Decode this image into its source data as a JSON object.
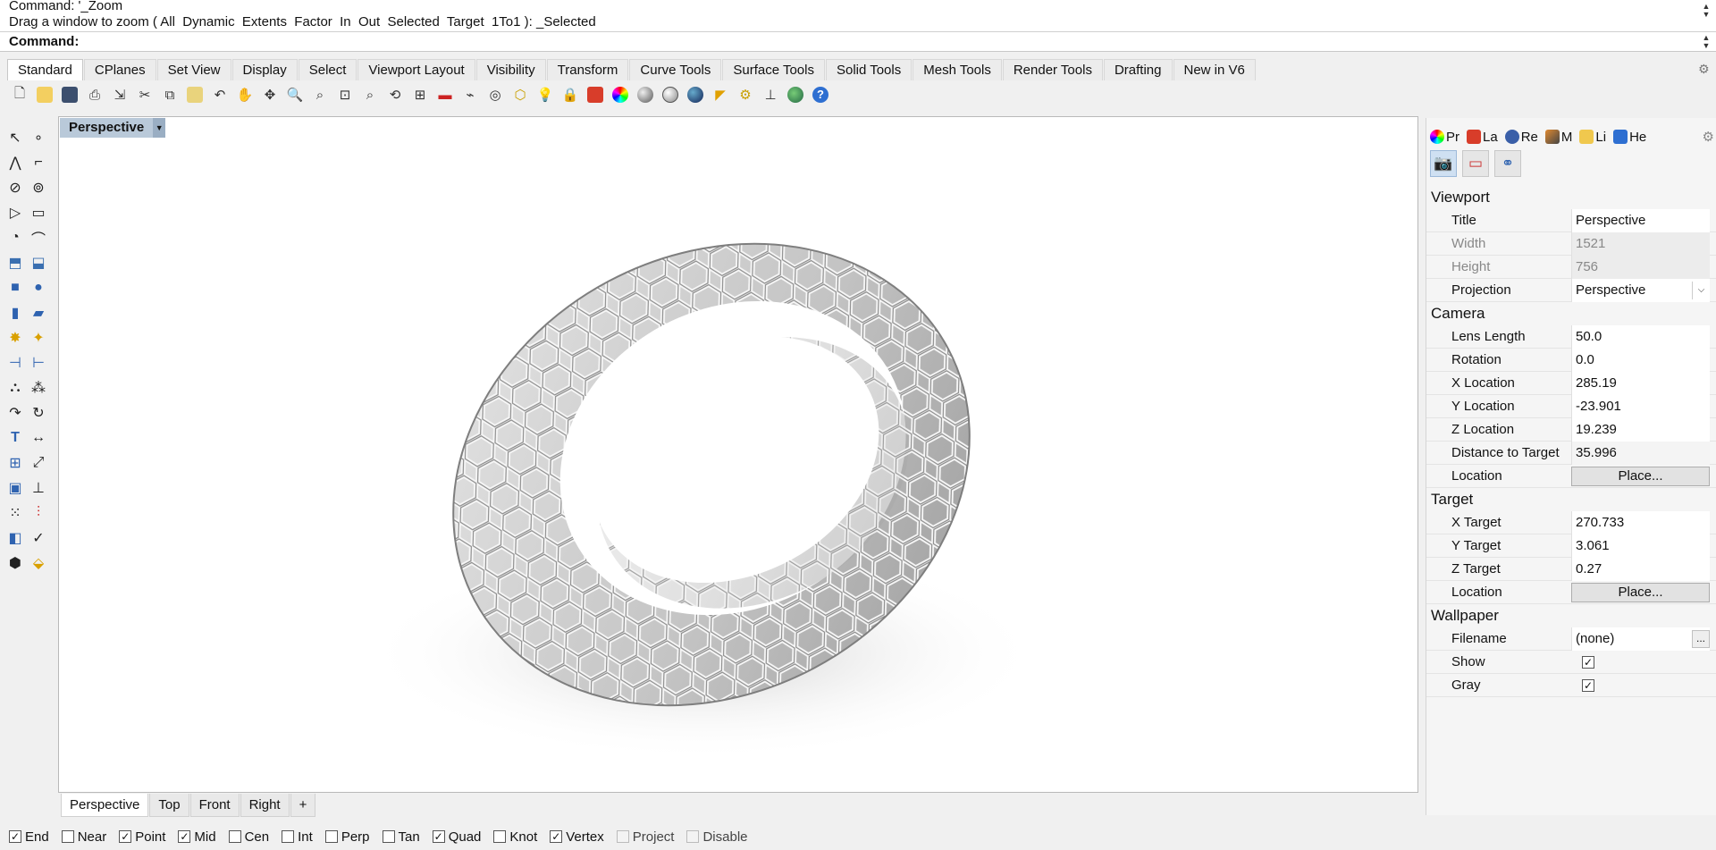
{
  "command": {
    "history_line1": "Command: '_Zoom",
    "history_line2": "Drag a window to zoom ( All  Dynamic  Extents  Factor  In  Out  Selected  Target  1To1 ): _Selected",
    "prompt_label": "Command:"
  },
  "toolbar_tabs": [
    {
      "label": "Standard",
      "active": true
    },
    {
      "label": "CPlanes"
    },
    {
      "label": "Set View"
    },
    {
      "label": "Display"
    },
    {
      "label": "Select"
    },
    {
      "label": "Viewport Layout"
    },
    {
      "label": "Visibility"
    },
    {
      "label": "Transform"
    },
    {
      "label": "Curve Tools"
    },
    {
      "label": "Surface Tools"
    },
    {
      "label": "Solid Tools"
    },
    {
      "label": "Mesh Tools"
    },
    {
      "label": "Render Tools"
    },
    {
      "label": "Drafting"
    },
    {
      "label": "New in V6"
    }
  ],
  "viewport": {
    "title": "Perspective",
    "tabs": [
      "Perspective",
      "Top",
      "Front",
      "Right"
    ],
    "add_tab": "+"
  },
  "osnaps": [
    {
      "label": "End",
      "checked": true
    },
    {
      "label": "Near",
      "checked": false
    },
    {
      "label": "Point",
      "checked": true
    },
    {
      "label": "Mid",
      "checked": true
    },
    {
      "label": "Cen",
      "checked": false
    },
    {
      "label": "Int",
      "checked": false
    },
    {
      "label": "Perp",
      "checked": false
    },
    {
      "label": "Tan",
      "checked": false
    },
    {
      "label": "Quad",
      "checked": true
    },
    {
      "label": "Knot",
      "checked": false
    },
    {
      "label": "Vertex",
      "checked": true
    },
    {
      "label": "Project",
      "checked": false,
      "disabled": true
    },
    {
      "label": "Disable",
      "checked": false,
      "disabled": true
    }
  ],
  "panel": {
    "tabs": [
      "Pr",
      "La",
      "Re",
      "M",
      "Li",
      "He"
    ],
    "sections": {
      "viewport": {
        "title": "Viewport",
        "title_label": "Title",
        "title_value": "Perspective",
        "width_label": "Width",
        "width_value": "1521",
        "height_label": "Height",
        "height_value": "756",
        "projection_label": "Projection",
        "projection_value": "Perspective"
      },
      "camera": {
        "title": "Camera",
        "lens_label": "Lens Length",
        "lens_value": "50.0",
        "rotation_label": "Rotation",
        "rotation_value": "0.0",
        "xloc_label": "X Location",
        "xloc_value": "285.19",
        "yloc_label": "Y Location",
        "yloc_value": "-23.901",
        "zloc_label": "Z Location",
        "zloc_value": "19.239",
        "dist_label": "Distance to Target",
        "dist_value": "35.996",
        "location_label": "Location",
        "place_button": "Place..."
      },
      "target": {
        "title": "Target",
        "xt_label": "X Target",
        "xt_value": "270.733",
        "yt_label": "Y Target",
        "yt_value": "3.061",
        "zt_label": "Z Target",
        "zt_value": "0.27",
        "location_label": "Location",
        "place_button": "Place..."
      },
      "wallpaper": {
        "title": "Wallpaper",
        "filename_label": "Filename",
        "filename_value": "(none)",
        "ellipsis": "...",
        "show_label": "Show",
        "show_checked": true,
        "gray_label": "Gray",
        "gray_checked": true
      }
    }
  }
}
